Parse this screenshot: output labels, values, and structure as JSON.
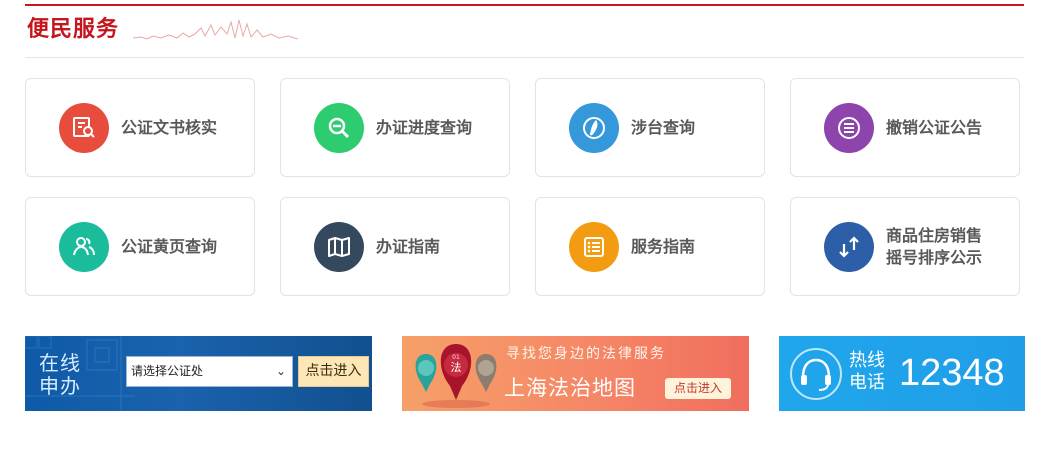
{
  "section": {
    "title": "便民服务"
  },
  "services": [
    {
      "label": "公证文书核实",
      "icon": "document-search-icon",
      "color": "#e74c3c"
    },
    {
      "label": "办证进度查询",
      "icon": "magnifier-minus-icon",
      "color": "#2ecc71"
    },
    {
      "label": "涉台查询",
      "icon": "taiwan-map-icon",
      "color": "#3498db"
    },
    {
      "label": "撤销公证公告",
      "icon": "list-circle-icon",
      "color": "#8e44ad"
    },
    {
      "label": "公证黄页查询",
      "icon": "people-icon",
      "color": "#1abc9c"
    },
    {
      "label": "办证指南",
      "icon": "map-book-icon",
      "color": "#34495e"
    },
    {
      "label": "服务指南",
      "icon": "checklist-icon",
      "color": "#f39c12"
    },
    {
      "label_line1": "商品住房销售",
      "label_line2": "摇号排序公示",
      "icon": "up-down-arrows-icon",
      "color": "#2c5fa8"
    }
  ],
  "banner_online": {
    "title_line1": "在线",
    "title_line2": "申办",
    "select_value": "请选择公证处",
    "button_label": "点击进入"
  },
  "banner_map": {
    "pin_text": "法",
    "pin_number": "01",
    "subtitle": "寻找您身边的法律服务",
    "title": "上海法治地图",
    "button_label": "点击进入"
  },
  "banner_hotline": {
    "label_line1": "热线",
    "label_line2": "电话",
    "number": "12348"
  }
}
